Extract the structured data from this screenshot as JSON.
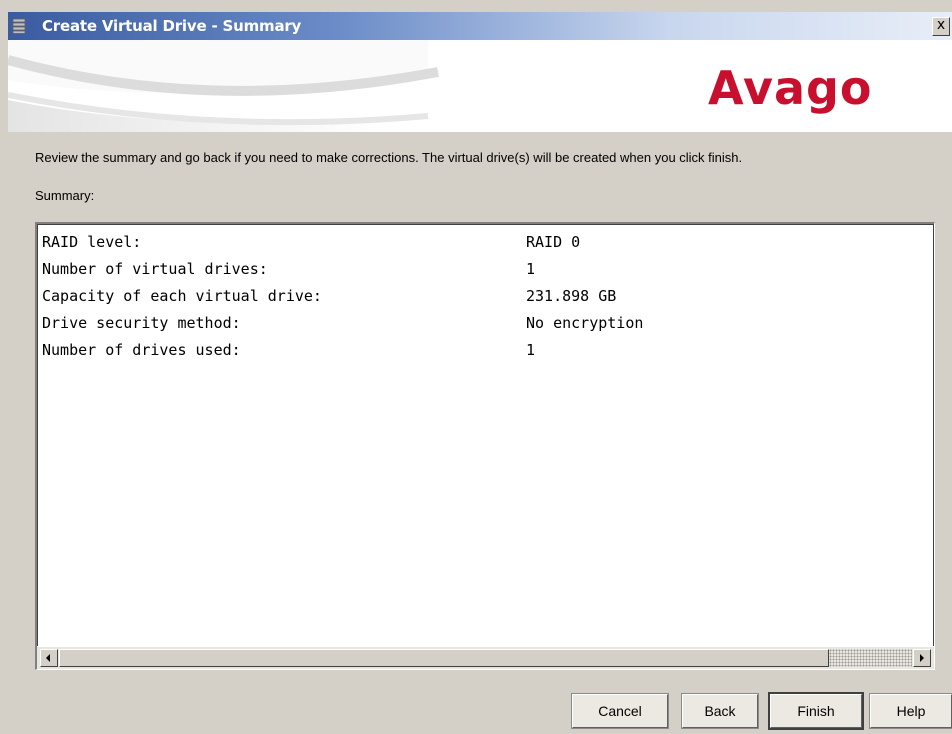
{
  "window": {
    "title": "Create Virtual Drive - Summary",
    "close_label": "x"
  },
  "banner": {
    "logo_text": "Avago",
    "logo_color": "#c8102e"
  },
  "content": {
    "instruction": "Review the summary and go back if you need to make corrections. The virtual drive(s) will be created when you click finish.",
    "summary_label": "Summary:"
  },
  "summary": {
    "rows": [
      {
        "key": "RAID level:",
        "value": "RAID 0"
      },
      {
        "key": "Number of virtual drives:",
        "value": "1"
      },
      {
        "key": "Capacity of each virtual drive:",
        "value": "231.898 GB"
      },
      {
        "key": "Drive security method:",
        "value": "No encryption"
      },
      {
        "key": "Number of drives used:",
        "value": "1"
      }
    ]
  },
  "buttons": {
    "cancel": "Cancel",
    "back": "Back",
    "finish": "Finish",
    "help": "Help"
  }
}
